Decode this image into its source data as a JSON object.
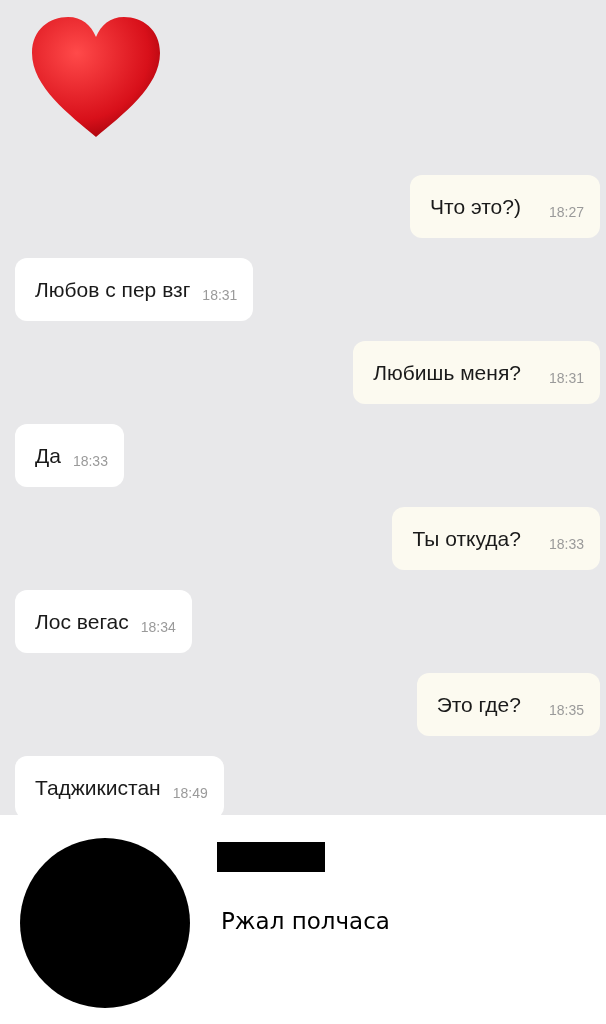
{
  "messages": [
    {
      "kind": "sent",
      "text": "Что это?)",
      "time": "18:27"
    },
    {
      "kind": "received",
      "text": "Любов с пер взг",
      "time": "18:31"
    },
    {
      "kind": "sent",
      "text": "Любишь меня?",
      "time": "18:31"
    },
    {
      "kind": "received",
      "text": "Да",
      "time": "18:33"
    },
    {
      "kind": "sent",
      "text": "Ты откуда?",
      "time": "18:33"
    },
    {
      "kind": "received",
      "text": "Лос вегас",
      "time": "18:34"
    },
    {
      "kind": "sent",
      "text": "Это где?",
      "time": "18:35"
    },
    {
      "kind": "received",
      "text": "Таджикистан",
      "time": "18:49"
    }
  ],
  "post": {
    "caption": "Ржал полчаса"
  }
}
